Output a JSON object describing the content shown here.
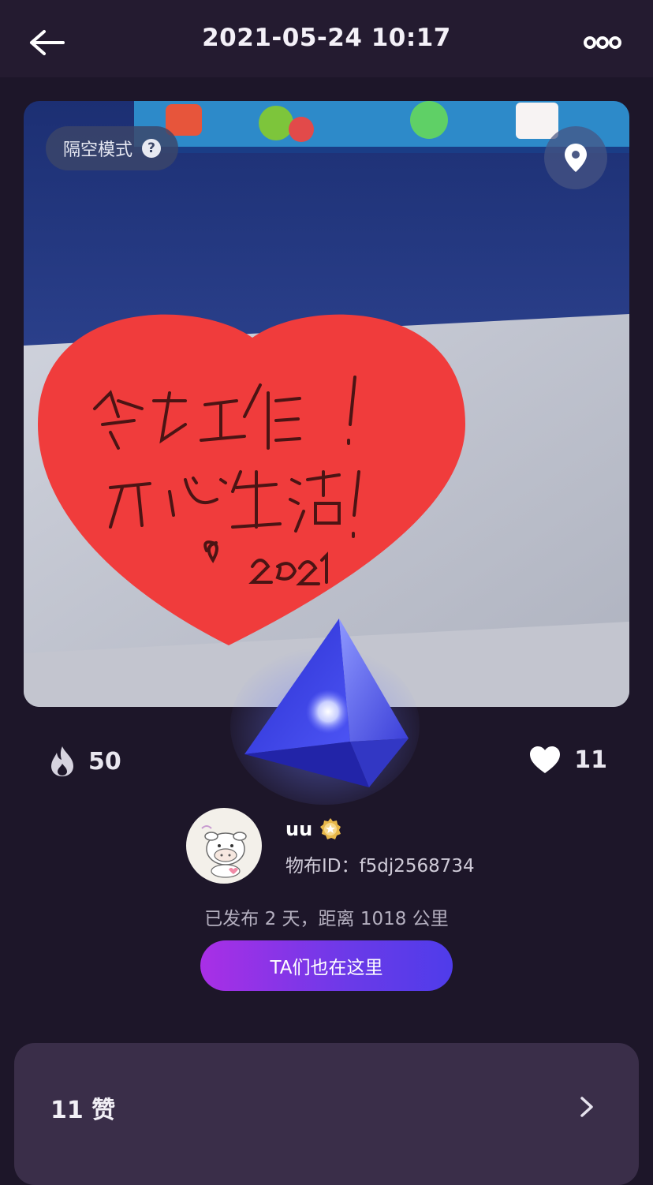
{
  "header": {
    "title": "2021-05-24 10:17"
  },
  "photo": {
    "mode_label": "隔空模式",
    "help_glyph": "?",
    "note_lines": [
      "努力工作！",
      "开心生活！",
      "2021"
    ],
    "note_color": "#f03c3c"
  },
  "stats": {
    "heat_count": "50",
    "like_count": "11"
  },
  "user": {
    "name": "uu",
    "id_text": "物布ID：f5dj2568734",
    "publish_info": "已发布 2 天，距离 1018 公里"
  },
  "actions": {
    "ta_button_label": "TA们也在这里"
  },
  "likes_panel": {
    "label": "11 赞"
  },
  "icons": [
    "back-arrow-icon",
    "more-dots-icon",
    "help-icon",
    "location-pin-icon",
    "fire-icon",
    "heart-icon",
    "badge-icon",
    "chevron-right-icon"
  ],
  "colors": {
    "background": "#1d1629",
    "header": "#241b30",
    "button_gradient_start": "#a92fe6",
    "button_gradient_end": "#4f3cea",
    "panel": "#3a2e49"
  }
}
